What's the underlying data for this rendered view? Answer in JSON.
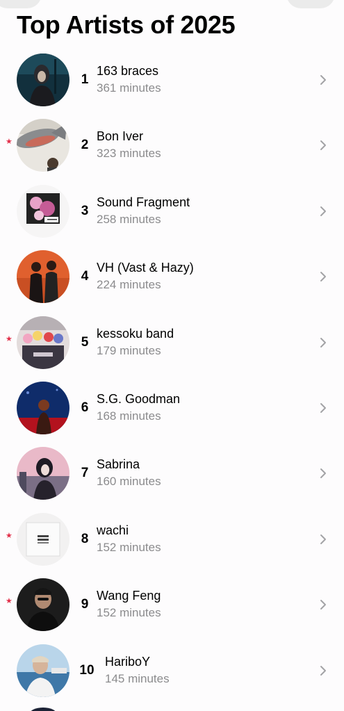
{
  "page": {
    "title": "Top Artists of 2025"
  },
  "artists": [
    {
      "rank": "1",
      "name": "163 braces",
      "minutes": "361 minutes",
      "starred": false,
      "avatar": "photo-dark-teal"
    },
    {
      "rank": "2",
      "name": "Bon Iver",
      "minutes": "323 minutes",
      "starred": true,
      "avatar": "photo-fish-on-table"
    },
    {
      "rank": "3",
      "name": "Sound Fragment",
      "minutes": "258 minutes",
      "starred": false,
      "avatar": "album-art-pink-collage"
    },
    {
      "rank": "4",
      "name": "VH (Vast & Hazy)",
      "minutes": "224 minutes",
      "starred": false,
      "avatar": "photo-orange-duo"
    },
    {
      "rank": "5",
      "name": "kessoku band",
      "minutes": "179 minutes",
      "starred": true,
      "avatar": "anime-band-group"
    },
    {
      "rank": "6",
      "name": "S.G. Goodman",
      "minutes": "168 minutes",
      "starred": false,
      "avatar": "photo-blue-red-stage"
    },
    {
      "rank": "7",
      "name": "Sabrina",
      "minutes": "160 minutes",
      "starred": false,
      "avatar": "photo-pink-sky-woman"
    },
    {
      "rank": "8",
      "name": "wachi",
      "minutes": "152 minutes",
      "starred": true,
      "avatar": "album-art-white-square"
    },
    {
      "rank": "9",
      "name": "Wang Feng",
      "minutes": "152 minutes",
      "starred": true,
      "avatar": "photo-man-black"
    },
    {
      "rank": "10",
      "name": "HariboY",
      "minutes": "145 minutes",
      "starred": false,
      "avatar": "photo-harbor-man"
    }
  ],
  "icons": {
    "star": "star-icon",
    "disclosure": "chevron-right-icon"
  },
  "colors": {
    "star": "#e2304a",
    "secondary_text": "#8b8b8d",
    "chevron": "#a3a3a6"
  }
}
